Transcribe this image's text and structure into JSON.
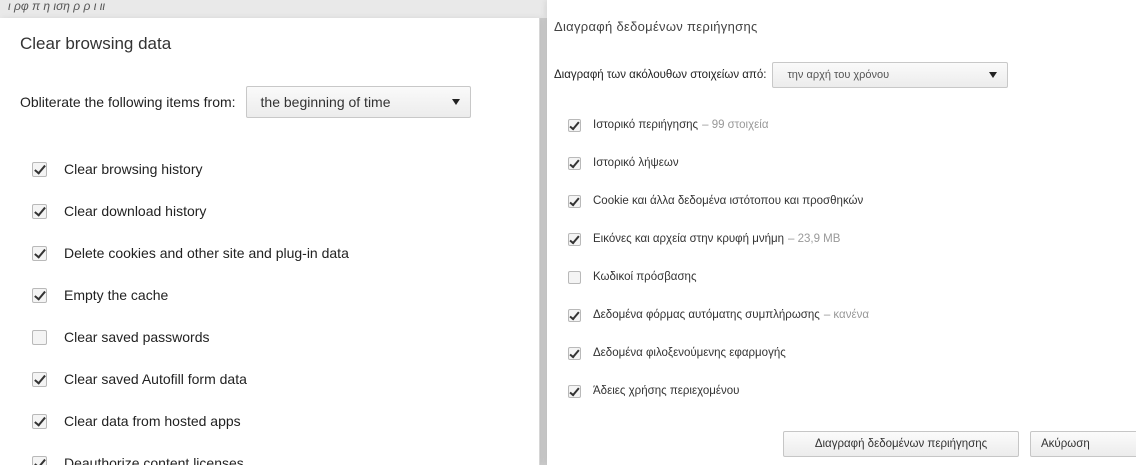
{
  "top_strip": "ι ρφ π η ιση ρ ρ ι ιι",
  "left_dialog": {
    "title": "Clear browsing data",
    "from_label": "Obliterate the following items from:",
    "period_value": "the beginning of time",
    "items": [
      {
        "label": "Clear browsing history",
        "checked": true
      },
      {
        "label": "Clear download history",
        "checked": true
      },
      {
        "label": "Delete cookies and other site and plug-in data",
        "checked": true
      },
      {
        "label": "Empty the cache",
        "checked": true
      },
      {
        "label": "Clear saved passwords",
        "checked": false
      },
      {
        "label": "Clear saved Autofill form data",
        "checked": true
      },
      {
        "label": "Clear data from hosted apps",
        "checked": true
      },
      {
        "label": "Deauthorize content licenses",
        "checked": true
      }
    ]
  },
  "right_dialog": {
    "title": "Διαγραφή δεδομένων περιήγησης",
    "from_label": "Διαγραφή των ακόλουθων στοιχείων από:",
    "period_value": "την αρχή του χρόνου",
    "items": [
      {
        "label": "Ιστορικό περιήγησης",
        "sub": "– 99 στοιχεία",
        "checked": true
      },
      {
        "label": "Ιστορικό λήψεων",
        "sub": "",
        "checked": true
      },
      {
        "label": "Cookie και άλλα δεδομένα ιστότοπου και προσθηκών",
        "sub": "",
        "checked": true
      },
      {
        "label": "Εικόνες και αρχεία στην κρυφή μνήμη",
        "sub": "– 23,9 MB",
        "checked": true
      },
      {
        "label": "Κωδικοί πρόσβασης",
        "sub": "",
        "checked": false
      },
      {
        "label": "Δεδομένα φόρμας αυτόματης συμπλήρωσης",
        "sub": "– κανένα",
        "checked": true
      },
      {
        "label": "Δεδομένα φιλοξενούμενης εφαρμογής",
        "sub": "",
        "checked": true
      },
      {
        "label": "Άδειες χρήσης περιεχομένου",
        "sub": "",
        "checked": true
      }
    ],
    "clear_button": "Διαγραφή δεδομένων περιήγησης",
    "cancel_button": "Ακύρωση"
  }
}
